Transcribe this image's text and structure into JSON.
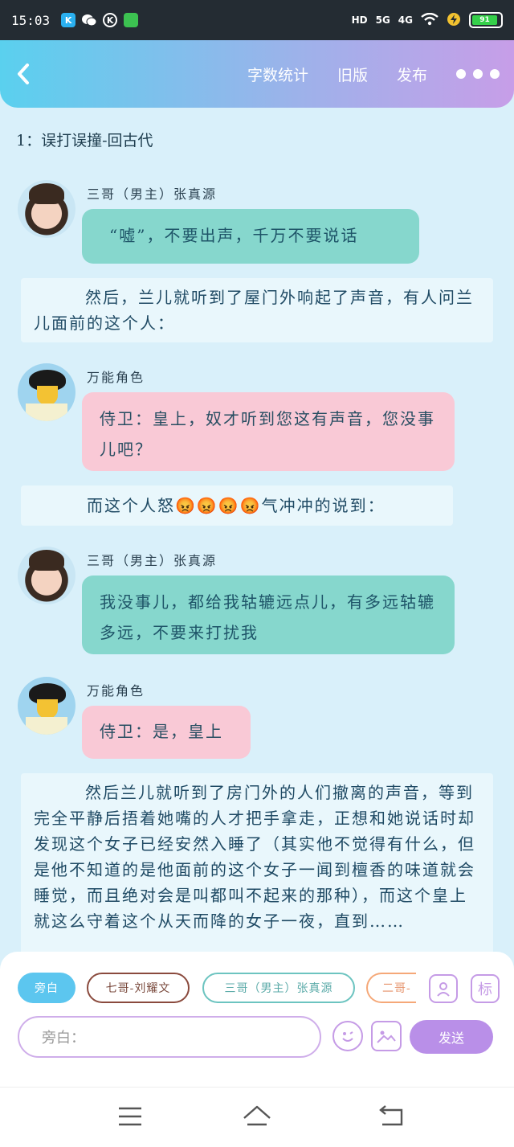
{
  "status_bar": {
    "time": "15:03",
    "network_left": "HD",
    "network_5g": "5G",
    "network_4g": "4G",
    "battery_label": "91"
  },
  "app_bar": {
    "word_count": "字数统计",
    "old_version": "旧版",
    "publish": "发布"
  },
  "chapter": {
    "title": "1：误打误撞-回古代"
  },
  "messages": [
    {
      "speaker": "三哥（男主）张真源",
      "text": "“嘘”，不要出声，千万不要说话"
    },
    {
      "narration": "然后，兰儿就听到了屋门外响起了声音，有人问兰儿面前的这个人："
    },
    {
      "speaker": "万能角色",
      "text": "侍卫：皇上，奴才听到您这有声音，您没事儿吧？"
    },
    {
      "narration": "而这个人怒😡😡😡😡气冲冲的说到："
    },
    {
      "speaker": "三哥（男主）张真源",
      "text": "我没事儿，都给我轱辘远点儿，有多远轱辘多远，不要来打扰我"
    },
    {
      "speaker": "万能角色",
      "text": "侍卫：是，皇上"
    },
    {
      "narration": "然后兰儿就听到了房门外的人们撤离的声音，等到完全平静后捂着她嘴的人才把手拿走，正想和她说话时却发现这个女子已经安然入睡了（其实他不觉得有什么，但是他不知道的是他面前的这个女子一闻到檀香的味道就会睡觉，而且绝对会是叫都叫不起来的那种），而这个皇上就这么守着这个从天而降的女子一夜，直到…… "
    }
  ],
  "composer": {
    "chips": [
      "旁白",
      "七哥-刘耀文",
      "三哥（男主）张真源",
      "二哥-"
    ],
    "input_placeholder": "旁白：",
    "send_label": "发送",
    "mark_label": "标"
  }
}
